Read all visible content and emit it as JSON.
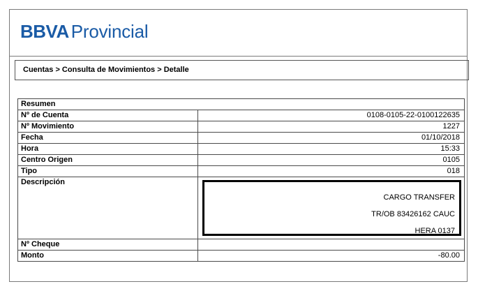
{
  "brand": {
    "bbva": "BBVA",
    "provincial": "Provincial"
  },
  "breadcrumb": "Cuentas > Consulta de Movimientos > Detalle",
  "summary": {
    "heading": "Resumen",
    "rows": [
      {
        "label": "Nº de Cuenta",
        "value": "0108-0105-22-0100122635"
      },
      {
        "label": "Nº Movimiento",
        "value": "1227"
      },
      {
        "label": "Fecha",
        "value": "01/10/2018"
      },
      {
        "label": "Hora",
        "value": "15:33"
      },
      {
        "label": "Centro Origen",
        "value": "0105"
      },
      {
        "label": "Tipo",
        "value": "018"
      }
    ],
    "description": {
      "label": "Descripción",
      "lines": [
        "CARGO TRANSFER",
        "TR/OB 83426162 CAUC",
        "HERA 0137"
      ]
    },
    "cheque": {
      "label": "Nº Cheque",
      "value": ""
    },
    "amount": {
      "label": "Monto",
      "value": "-80.00"
    }
  },
  "colors": {
    "brand_blue": "#1a5ba6",
    "border": "#4a4a4a"
  }
}
